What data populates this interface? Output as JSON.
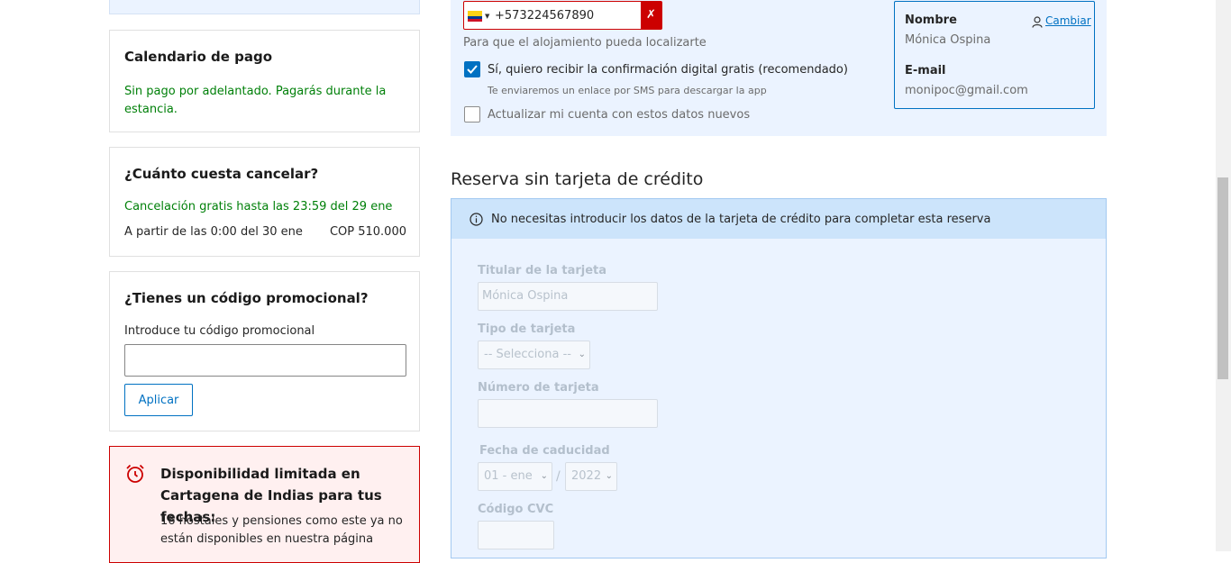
{
  "sidebar": {
    "payment_schedule": {
      "title": "Calendario de pago",
      "text": "Sin pago por adelantado. Pagarás durante la estancia."
    },
    "cancellation": {
      "title": "¿Cuánto cuesta cancelar?",
      "free_text": "Cancelación gratis hasta las 23:59 del 29 ene",
      "fee_from": "A partir de las 0:00 del 30 ene",
      "fee_amount": "COP 510.000"
    },
    "promo": {
      "title": "¿Tienes un código promocional?",
      "label": "Introduce tu código promocional",
      "value": "",
      "apply_label": "Aplicar"
    },
    "availability": {
      "title": "Disponibilidad limitada en Cartagena de Indias para tus fechas:",
      "text": "16 hostales y pensiones como este ya no están disponibles en nuestra página"
    }
  },
  "contact": {
    "phone_value": "+573224567890",
    "phone_error_icon": "✗",
    "phone_hint": "Para que el alojamiento pueda localizarte",
    "confirm_label": "Sí, quiero recibir la confirmación digital gratis (recomendado)",
    "confirm_checked": true,
    "confirm_subtext": "Te enviaremos un enlace por SMS para descargar la app",
    "update_label": "Actualizar mi cuenta con estos datos nuevos",
    "update_checked": false
  },
  "user": {
    "name_label": "Nombre",
    "name_value": "Mónica Ospina",
    "change_label": "Cambiar",
    "email_label": "E-mail",
    "email_value": "monipoc@gmail.com"
  },
  "card": {
    "section_title": "Reserva sin tarjeta de crédito",
    "info_text": "No necesitas introducir los datos de la tarjeta de crédito para completar esta reserva",
    "holder_label": "Titular de la tarjeta",
    "holder_value": "Mónica Ospina",
    "type_label": "Tipo de tarjeta",
    "type_value": "-- Selecciona --",
    "number_label": "Número de tarjeta",
    "number_value": "",
    "expiry_label": "Fecha de caducidad",
    "expiry_month": "01 - ene",
    "expiry_separator": "/",
    "expiry_year": "2022",
    "cvc_label": "Código CVC",
    "cvc_value": ""
  },
  "colors": {
    "primary": "#0071c2",
    "success": "#008009",
    "error": "#cc0000",
    "panel": "#ebf3ff"
  }
}
